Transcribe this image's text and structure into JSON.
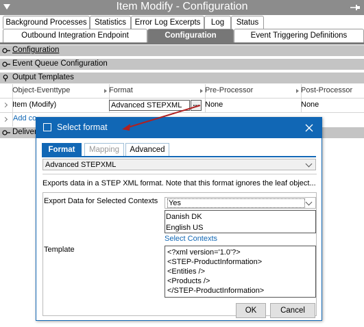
{
  "window": {
    "title": "Item Modify - Configuration"
  },
  "tabs_row1": [
    "Background Processes",
    "Statistics",
    "Error Log Excerpts",
    "Log",
    "Status"
  ],
  "tabs_row2": [
    "Outbound Integration Endpoint",
    "Configuration",
    "Event Triggering Definitions"
  ],
  "sections": {
    "configuration": "Configuration",
    "event_queue": "Event Queue Configuration",
    "output_templates": "Output Templates",
    "delivery": "Deliver"
  },
  "table": {
    "headers": [
      "Object-Eventtype",
      "Format",
      "Pre-Processor",
      "Post-Processor"
    ],
    "row": [
      "Item (Modify)",
      "Advanced STEPXML",
      "Pre-Processor",
      "Post-Processor"
    ],
    "row_values": {
      "object": "Item (Modify)",
      "format": "Advanced STEPXML",
      "pre": "None",
      "post": "None"
    },
    "add_link": "Add co",
    "browse_button": "..."
  },
  "dialog": {
    "title": "Select format",
    "tabs": [
      "Format",
      "Mapping",
      "Advanced"
    ],
    "format_value": "Advanced STEPXML",
    "description": "Exports data in a STEP XML format. Note that this format ignores the leaf object...",
    "export_label": "Export Data for Selected Contexts",
    "export_value": "Yes",
    "contexts": [
      "Danish DK",
      "English US"
    ],
    "select_contexts_link": "Select Contexts",
    "template_label": "Template",
    "template_lines": [
      "<?xml version='1.0'?>",
      "<STEP-ProductInformation>",
      "<Entities />",
      "<Products />",
      "</STEP-ProductInformation>"
    ],
    "ok": "OK",
    "cancel": "Cancel"
  },
  "colors": {
    "accent": "#1167b5",
    "annotation_arrow": "#b02020",
    "titlebar": "#8c8c8c"
  }
}
